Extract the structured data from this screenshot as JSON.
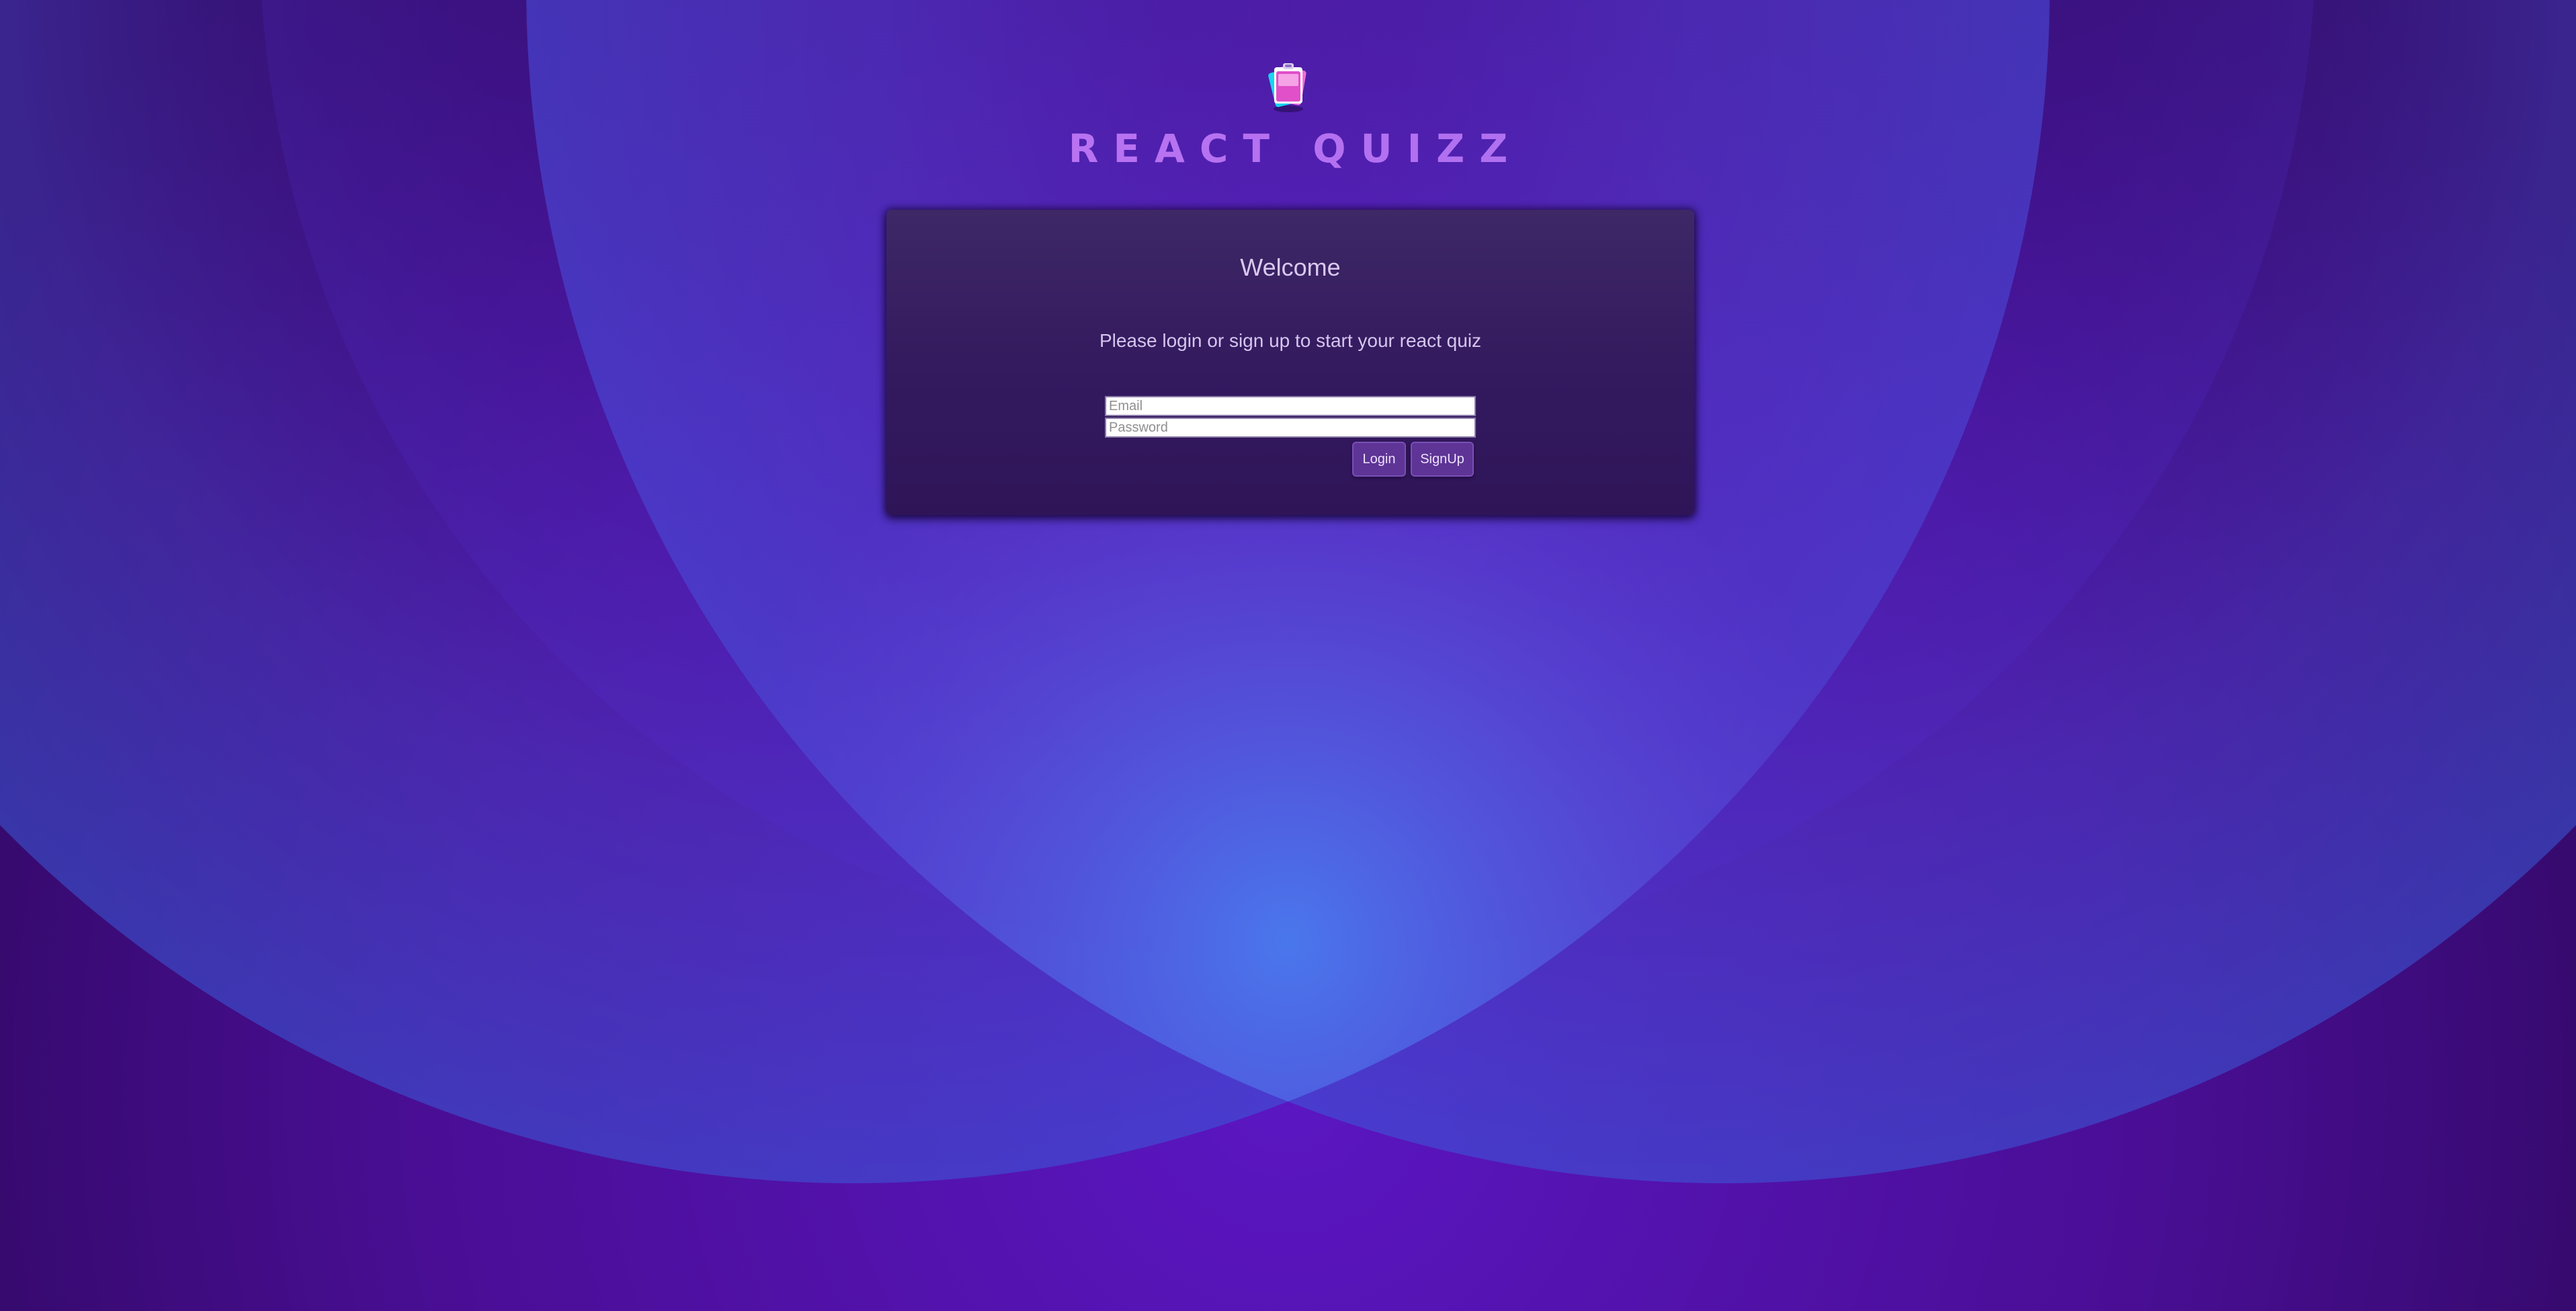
{
  "app": {
    "title": "REACT QUIZZ",
    "logo_icon": "quiz-cards-icon"
  },
  "login_card": {
    "title": "Welcome",
    "subtitle": "Please login or sign up to start your react quiz",
    "email_placeholder": "Email",
    "email_value": "",
    "password_placeholder": "Password",
    "password_value": "",
    "login_label": "Login",
    "signup_label": "SignUp"
  },
  "colors": {
    "background_dark": "#3a0c6e",
    "background_glow": "#4a6ee8",
    "brand_text": "#c072f2",
    "card_background": "#3a2363",
    "button_background": "#5e3496"
  }
}
